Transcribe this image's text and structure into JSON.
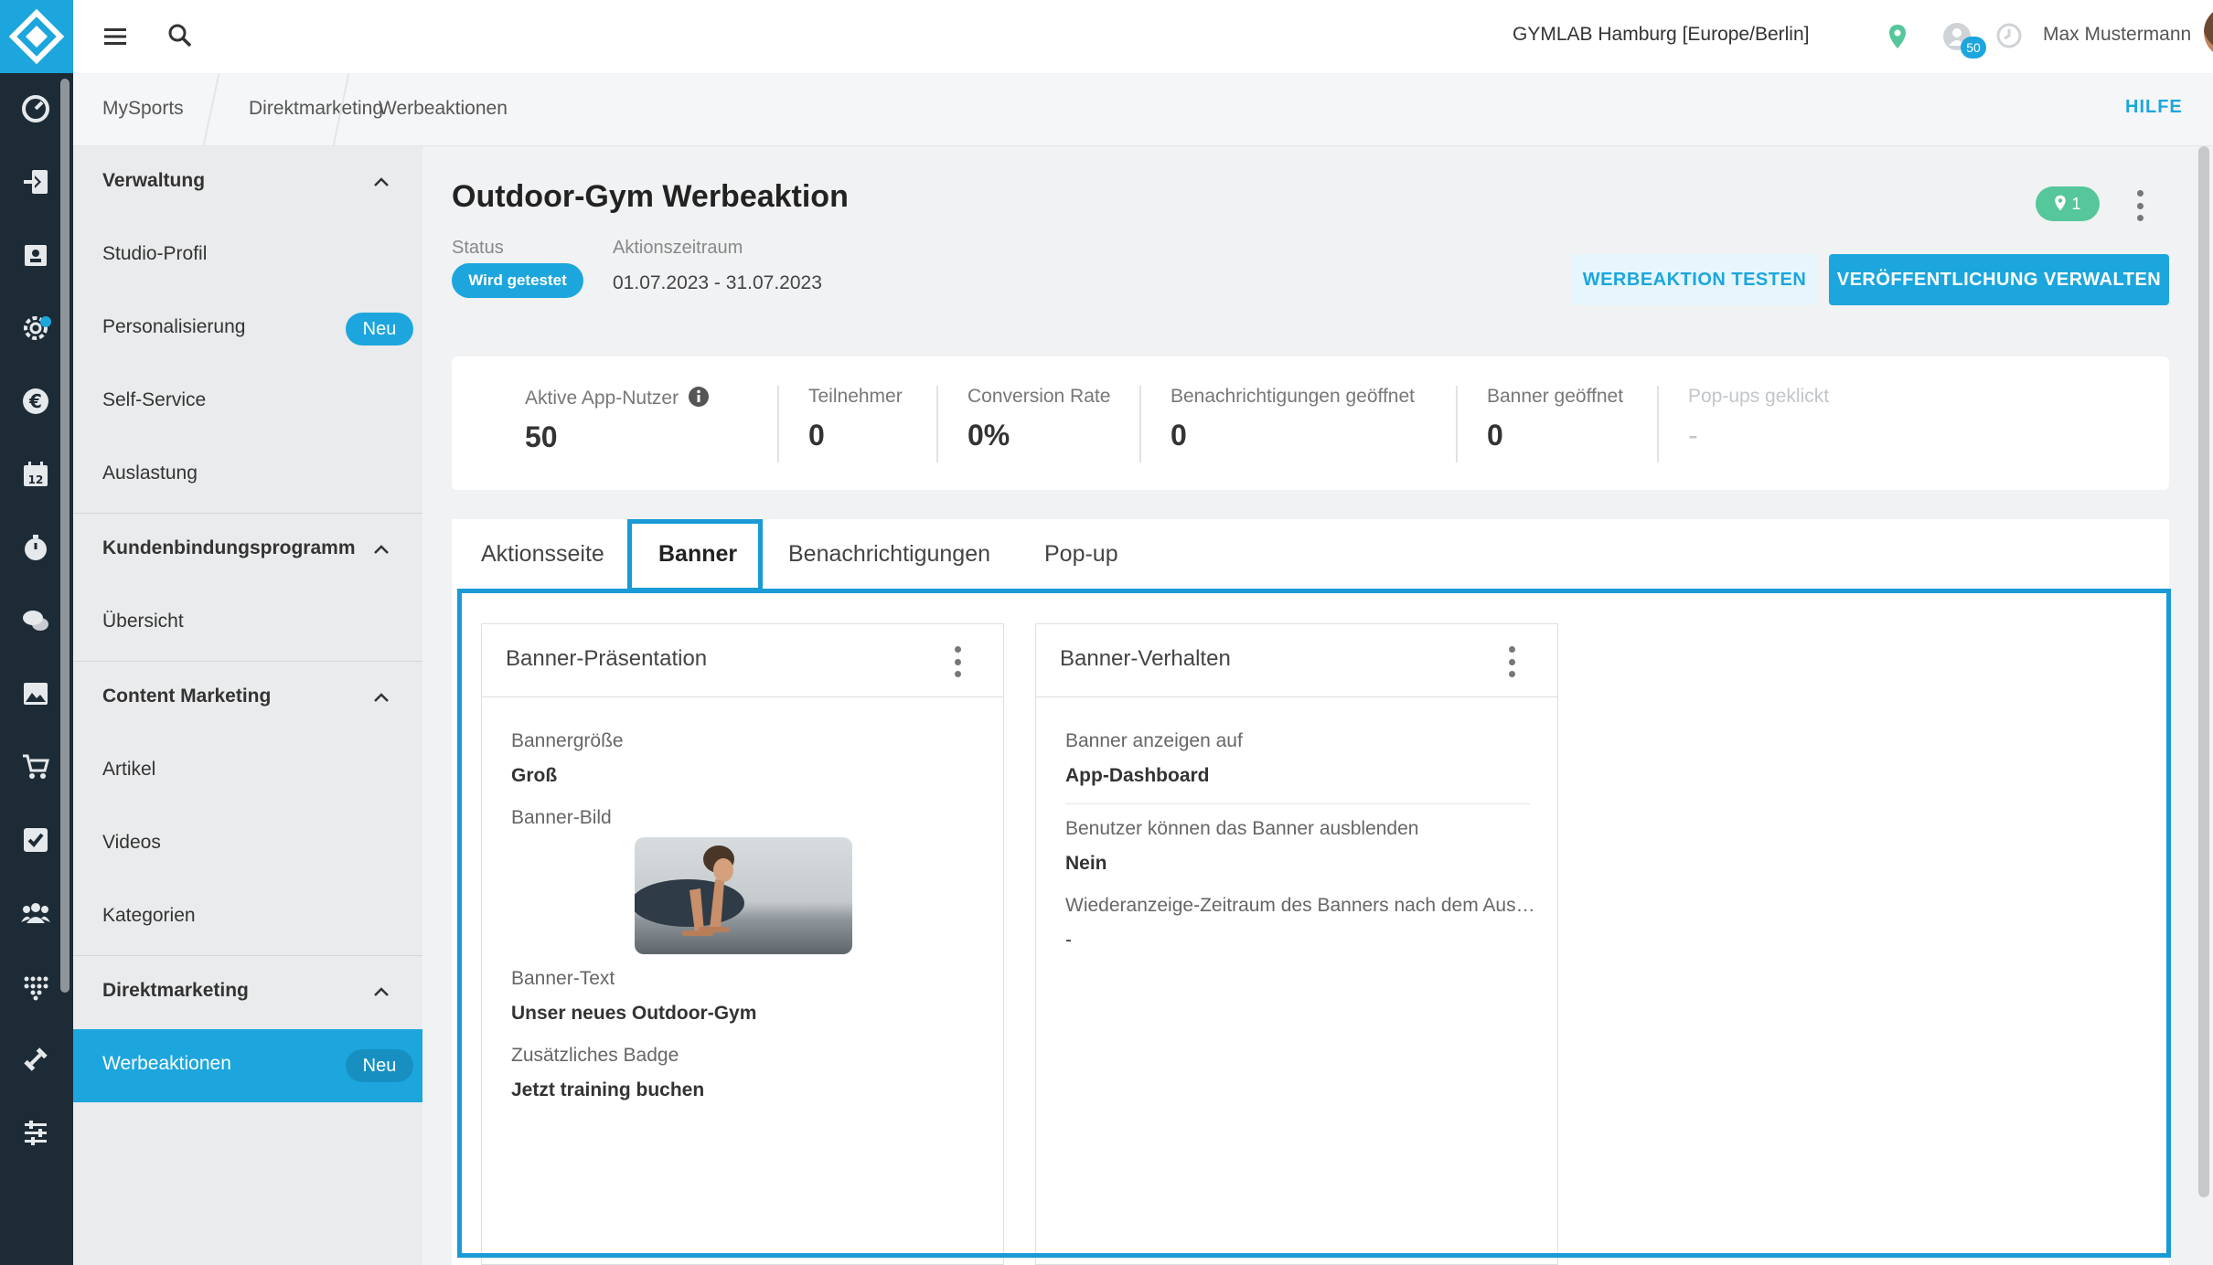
{
  "topbar": {
    "studio": "GYMLAB Hamburg [Europe/Berlin]",
    "notification_count": "50",
    "user_name": "Max Mustermann"
  },
  "breadcrumb": [
    "MySports",
    "Direktmarketing",
    "Werbeaktionen"
  ],
  "help_label": "HILFE",
  "sidebar": {
    "sections": [
      {
        "title": "Verwaltung",
        "items": [
          {
            "label": "Studio-Profil"
          },
          {
            "label": "Personalisierung",
            "badge": "Neu"
          },
          {
            "label": "Self-Service"
          },
          {
            "label": "Auslastung"
          }
        ]
      },
      {
        "title": "Kundenbindungsprogramm",
        "items": [
          {
            "label": "Übersicht"
          }
        ]
      },
      {
        "title": "Content Marketing",
        "items": [
          {
            "label": "Artikel"
          },
          {
            "label": "Videos"
          },
          {
            "label": "Kategorien"
          }
        ]
      },
      {
        "title": "Direktmarketing",
        "items": [
          {
            "label": "Werbeaktionen",
            "badge": "Neu",
            "active": true
          }
        ]
      }
    ]
  },
  "promo": {
    "title": "Outdoor-Gym Werbeaktion",
    "status_label": "Status",
    "status_value": "Wird getestet",
    "period_label": "Aktionszeitraum",
    "period_value": "01.07.2023 - 31.07.2023",
    "location_count": "1",
    "btn_test": "WERBEAKTION TESTEN",
    "btn_publish": "VERÖFFENTLICHUNG VERWALTEN"
  },
  "stats": [
    {
      "label": "Aktive App-Nutzer",
      "value": "50"
    },
    {
      "label": "Teilnehmer",
      "value": "0"
    },
    {
      "label": "Conversion Rate",
      "value": "0%"
    },
    {
      "label": "Benachrichtigungen geöffnet",
      "value": "0"
    },
    {
      "label": "Banner geöffnet",
      "value": "0"
    },
    {
      "label": "Pop-ups geklickt",
      "value": "-"
    }
  ],
  "tabs": [
    "Aktionsseite",
    "Banner",
    "Benachrichtigungen",
    "Pop-up"
  ],
  "active_tab": "Banner",
  "banner_presentation": {
    "title": "Banner-Präsentation",
    "size_label": "Bannergröße",
    "size_value": "Groß",
    "image_label": "Banner-Bild",
    "text_label": "Banner-Text",
    "text_value": "Unser neues Outdoor-Gym",
    "badge_label": "Zusätzliches Badge",
    "badge_value": "Jetzt training buchen"
  },
  "banner_behavior": {
    "title": "Banner-Verhalten",
    "show_on_label": "Banner anzeigen auf",
    "show_on_value": "App-Dashboard",
    "hide_label": "Benutzer können das Banner ausblenden",
    "hide_value": "Nein",
    "redisplay_label": "Wiederanzeige-Zeitraum des Banners nach dem Aus…",
    "redisplay_value": "-"
  },
  "colors": {
    "accent": "#1ca6dd",
    "rail": "#1d2b36",
    "location_badge": "#55c79a",
    "highlight": "#1a9ad6"
  }
}
